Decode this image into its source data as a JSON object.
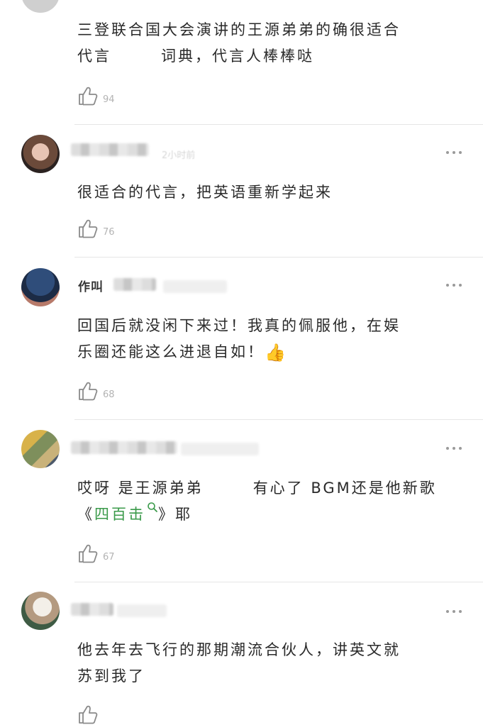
{
  "comments": [
    {
      "text": "三登联合国大会演讲的王源弟弟的确很适合",
      "text2a": "代言",
      "text2b": "词典，代言人棒棒哒",
      "likes": "94"
    },
    {
      "time": "2小时前",
      "text": "很适合的代言，把英语重新学起来",
      "likes": "76"
    },
    {
      "name_peek": "作叫",
      "text": "回国后就没闲下来过！我真的佩服他，在娱",
      "text2": "乐圈还能这么进退自如！",
      "emoji": "👍",
      "likes": "68"
    },
    {
      "text_a": "哎呀 是王源弟弟",
      "text_b": "有心了 BGM还是他新歌",
      "open_quote": "《",
      "song": "四百击",
      "close": "》耶",
      "likes": "67"
    },
    {
      "text": "他去年去飞行的那期潮流合伙人，讲英文就",
      "text2": "苏到我了"
    }
  ],
  "icons": {
    "like": "thumbs-up-outline-icon",
    "more": "more-dots-icon",
    "search": "search-icon"
  },
  "colors": {
    "song_link": "#3a9a4a",
    "divider": "#e6e6e6",
    "count": "#b3b3b3"
  }
}
